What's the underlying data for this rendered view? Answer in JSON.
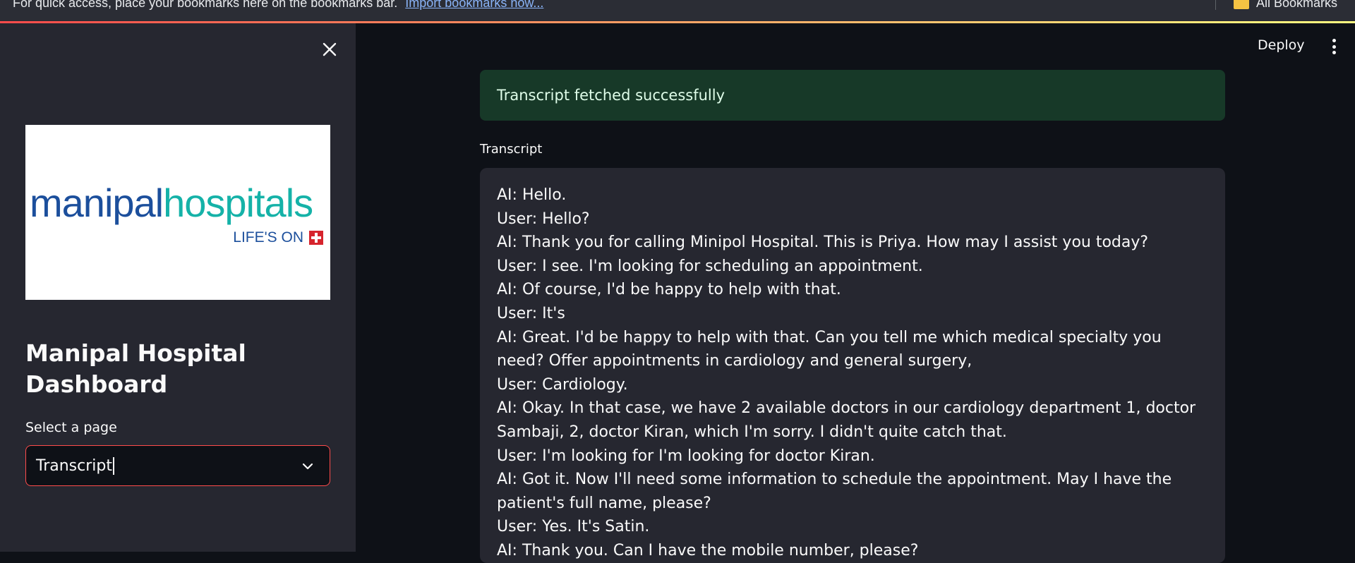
{
  "bookmarks_bar": {
    "message": "For quick access, place your bookmarks here on the bookmarks bar.",
    "import_link": "Import bookmarks now...",
    "all_bookmarks": "All Bookmarks"
  },
  "sidebar": {
    "logo": {
      "brand_part1": "manipal",
      "brand_part2": "hospitals",
      "tagline": "LIFE'S ON"
    },
    "title": "Manipal Hospital Dashboard",
    "select_label": "Select a page",
    "select_value": "Transcript"
  },
  "header": {
    "deploy_label": "Deploy"
  },
  "main": {
    "alert_text": "Transcript fetched successfully",
    "transcript_label": "Transcript",
    "transcript_lines": [
      "AI: Hello.",
      "User: Hello?",
      "AI: Thank you for calling Minipol Hospital. This is Priya. How may I assist you today?",
      "User: I see. I'm looking for scheduling an appointment.",
      "AI: Of course, I'd be happy to help with that.",
      "User: It's",
      "AI: Great. I'd be happy to help with that. Can you tell me which medical specialty you need? Offer appointments in cardiology and general surgery,",
      "User: Cardiology.",
      "AI: Okay. In that case, we have 2 available doctors in our cardiology department 1, doctor Sambaji, 2, doctor Kiran, which I'm sorry. I didn't quite catch that.",
      "User: I'm looking for I'm looking for doctor Kiran.",
      "AI: Got it. Now I'll need some information to schedule the appointment. May I have the patient's full name, please?",
      "User: Yes. It's Satin.",
      "AI: Thank you. Can I have the mobile number, please?"
    ]
  },
  "colors": {
    "accent": "#ff4b4b",
    "success_bg": "#173928",
    "sidebar_bg": "#262730",
    "app_bg": "#0e1117"
  }
}
